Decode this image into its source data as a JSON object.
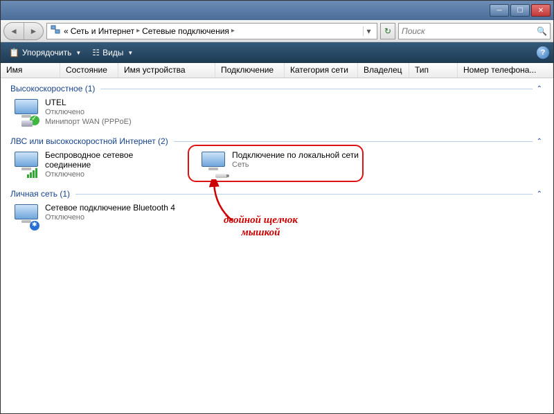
{
  "breadcrumb": {
    "prefix": "«",
    "item1": "Сеть и Интернет",
    "item2": "Сетевые подключения"
  },
  "search": {
    "placeholder": "Поиск"
  },
  "toolbar": {
    "organize": "Упорядочить",
    "views": "Виды"
  },
  "columns": {
    "name": "Имя",
    "status": "Состояние",
    "device": "Имя устройства",
    "connection": "Подключение",
    "category": "Категория сети",
    "owner": "Владелец",
    "type": "Тип",
    "phone": "Номер телефона..."
  },
  "groups": [
    {
      "title": "Высокоскоростное (1)",
      "items": [
        {
          "name": "UTEL",
          "sub1": "Отключено",
          "sub2": "Минипорт WAN (PPPoE)",
          "icon": "modem-check"
        }
      ]
    },
    {
      "title": "ЛВС или высокоскоростной Интернет (2)",
      "items": [
        {
          "name": "Беспроводное сетевое соединение",
          "sub1": "Отключено",
          "sub2": "",
          "icon": "wifi"
        },
        {
          "name": "Подключение по локальной сети",
          "sub1": "Сеть",
          "sub2": "",
          "icon": "lan",
          "highlighted": true
        }
      ]
    },
    {
      "title": "Личная сеть (1)",
      "items": [
        {
          "name": "Сетевое подключение Bluetooth 4",
          "sub1": "Отключено",
          "sub2": "",
          "icon": "bt"
        }
      ]
    }
  ],
  "annotation": {
    "line1": "двойной щелчок",
    "line2": "мышкой"
  }
}
